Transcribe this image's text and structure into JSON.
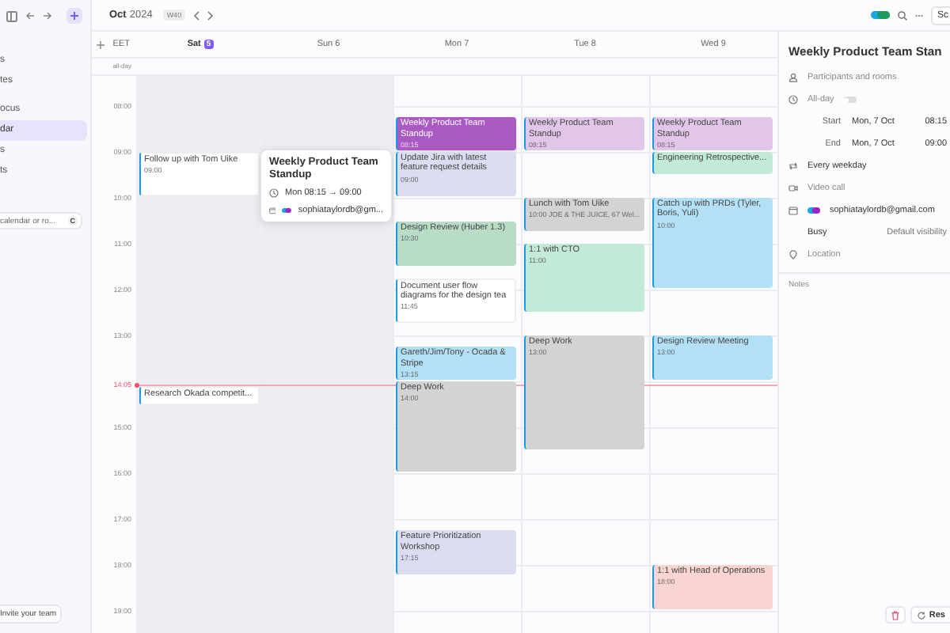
{
  "sidebar": {
    "sections": [
      [
        {
          "label": "s",
          "selected": false
        },
        {
          "label": "tes",
          "selected": false
        }
      ],
      [
        {
          "label": "ocus",
          "selected": false
        },
        {
          "label": "dar",
          "selected": true
        },
        {
          "label": "s",
          "selected": false
        },
        {
          "label": "ts",
          "selected": false
        }
      ]
    ],
    "search": {
      "placeholder": "calendar or ro...",
      "shortcut": "C"
    },
    "invite_button": "Invite your team"
  },
  "calendar": {
    "month": "Oct",
    "year": "2024",
    "week": "W40",
    "share_button": "Sc",
    "timezone": "EET",
    "all_day_label": "all-day",
    "days": [
      {
        "name": "Sat",
        "date": "5",
        "today": true,
        "weekend": true,
        "events": [
          {
            "title": "Follow up with Tom Uike",
            "time": "09:00",
            "kind": "hour",
            "color": "#ffffff",
            "selected": false
          },
          {
            "title": "Research Okada competit...",
            "kind": "task",
            "color": "#ffffff",
            "selected": false
          }
        ]
      },
      {
        "name": "Sun",
        "date": "6",
        "today": false,
        "weekend": true
      },
      {
        "name": "Mon",
        "date": "7",
        "today": false,
        "weekend": false,
        "events": [
          {
            "title": "Weekly Product Team Standup",
            "time": "08:15",
            "kind": "short",
            "color": "#a95bc3",
            "selected": true
          },
          {
            "title": "Update Jira with latest feature request details",
            "time": "09:00",
            "kind": "hour",
            "color": "#d9ddef",
            "selected": false
          },
          {
            "title": "Design Review (Huber 1.3)",
            "time": "10:30",
            "kind": "hour",
            "color": "#b8dcc8",
            "selected": false
          },
          {
            "title": "Document user flow diagrams for the design tea",
            "time": "11:45",
            "kind": "hour",
            "color": "#ffffff",
            "selected": false
          },
          {
            "title": "Gareth/Jim/Tony - Ocada & Stripe",
            "time": "13:15",
            "kind": "short",
            "color": "#b3e0f5",
            "selected": false
          },
          {
            "title": "Deep Work",
            "time": "14:00",
            "kind": "double",
            "color": "#d3d3d3",
            "selected": false
          },
          {
            "title": "Feature Prioritization Workshop",
            "time": "17:15",
            "kind": "hour",
            "color": "#d9ddef",
            "selected": false
          }
        ]
      },
      {
        "name": "Tue",
        "date": "8",
        "today": false,
        "weekend": false,
        "events": [
          {
            "title": "Weekly Product Team Standup",
            "time": "08:15",
            "kind": "short",
            "color": "#e2c6ea",
            "selected": false
          },
          {
            "title": "Lunch with Tom Uike",
            "time": "10:00 JOE & THE JUICE, 67 Wel...",
            "kind": "short",
            "color": "#d3d3d3",
            "selected": false
          },
          {
            "title": "1:1 with CTO",
            "time": "11:00",
            "kind": "long",
            "color": "#c3ead7",
            "selected": false
          },
          {
            "title": "Deep Work",
            "time": "13:00",
            "kind": "extended",
            "color": "#d3d3d3",
            "selected": false
          }
        ]
      },
      {
        "name": "Wed",
        "date": "9",
        "today": false,
        "weekend": false,
        "events": [
          {
            "title": "Weekly Product Team Standup",
            "time": "08:15",
            "kind": "short",
            "color": "#e2c6ea",
            "selected": false
          },
          {
            "title": "Engineering Retrospective...",
            "kind": "half",
            "color": "#c3ead7",
            "selected": false
          },
          {
            "title": "Catch up with PRDs (Tyler, Boris, Yuli)",
            "time": "10:00",
            "kind": "double",
            "color": "#b3e0f5",
            "selected": false
          },
          {
            "title": "Design Review Meeting",
            "time": "13:00",
            "kind": "hour",
            "color": "#b3e0f5",
            "selected": false
          },
          {
            "title": "1:1 with Head of Operations",
            "time": "18:00",
            "kind": "hour",
            "color": "#f8d4d2",
            "selected": false
          }
        ]
      }
    ],
    "hours": [
      "08:00",
      "09:00",
      "10:00",
      "11:00",
      "12:00",
      "13:00",
      "15:00",
      "16:00",
      "17:00",
      "18:00",
      "19:00"
    ],
    "now": {
      "label": "14:05"
    },
    "popover": {
      "title": "Weekly Product Team Standup",
      "time": "Mon 08:15 → 09:00",
      "calendar": "sophiataylordb@gm..."
    }
  },
  "panel": {
    "title": "Weekly Product Team Stan",
    "participants_placeholder": "Participants and rooms",
    "all_day": {
      "label": "All-day",
      "on": false
    },
    "start": {
      "label": "Start",
      "date": "Mon, 7 Oct",
      "time": "08:15"
    },
    "end": {
      "label": "End",
      "date": "Mon, 7 Oct",
      "time": "09:00"
    },
    "repeat": "Every weekday",
    "video_call": "Video call",
    "calendar": "sophiataylordb@gmail.com",
    "availability": "Busy",
    "visibility": "Default visibility",
    "location_placeholder": "Location",
    "notes_placeholder": "Notes",
    "reschedule_button": "Res"
  }
}
